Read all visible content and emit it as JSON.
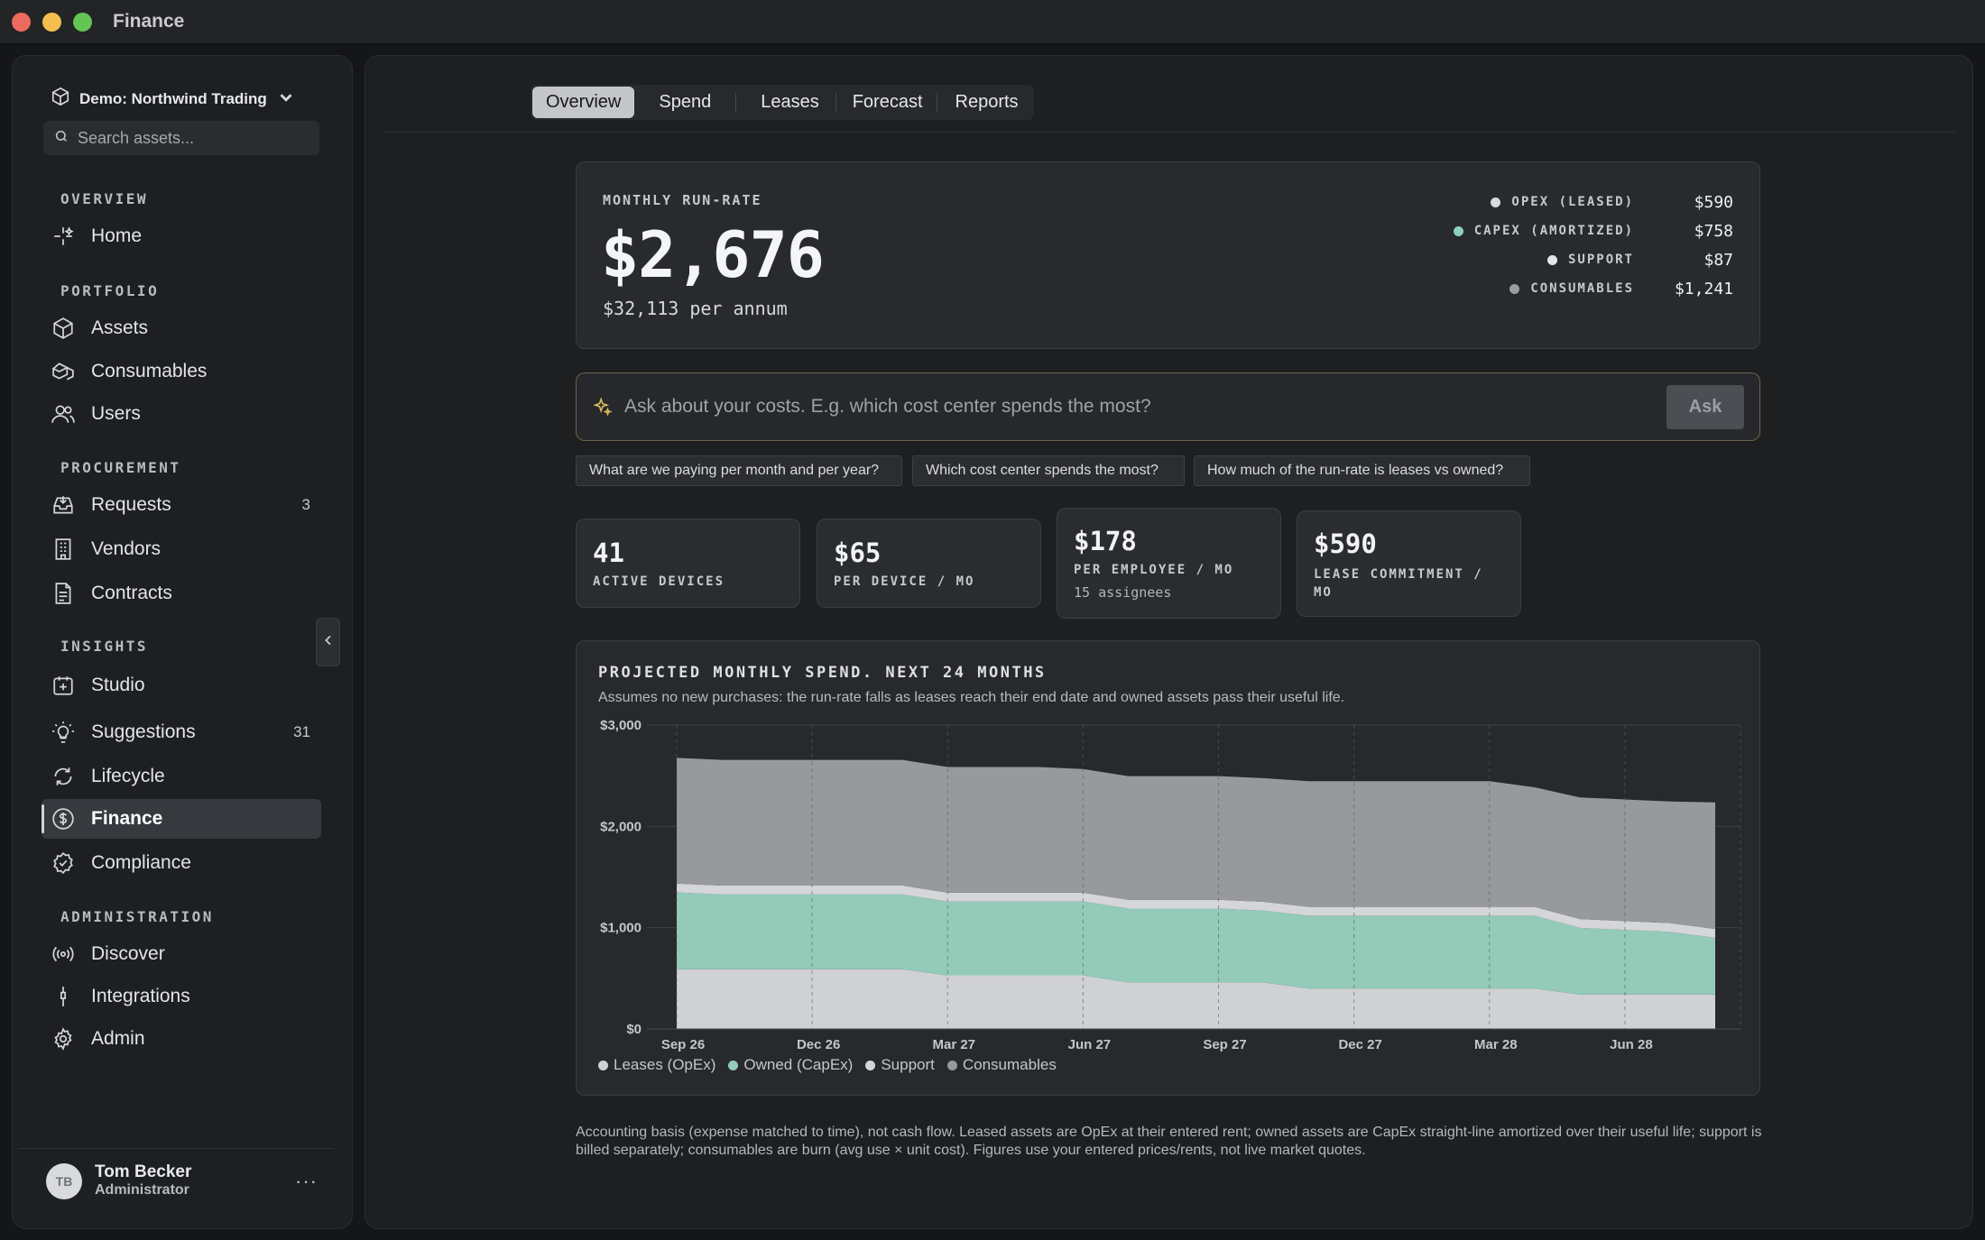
{
  "window": {
    "title": "Finance"
  },
  "sidebar": {
    "org_name": "Demo: Northwind Trading",
    "search_placeholder": "Search assets...",
    "sections": {
      "overview": "OVERVIEW",
      "portfolio": "PORTFOLIO",
      "procurement": "PROCUREMENT",
      "insights": "INSIGHTS",
      "administration": "ADMINISTRATION"
    },
    "items": {
      "home": "Home",
      "assets": "Assets",
      "consumables": "Consumables",
      "users": "Users",
      "requests": "Requests",
      "requests_count": "3",
      "vendors": "Vendors",
      "contracts": "Contracts",
      "studio": "Studio",
      "suggestions": "Suggestions",
      "suggestions_count": "31",
      "lifecycle": "Lifecycle",
      "finance": "Finance",
      "compliance": "Compliance",
      "discover": "Discover",
      "integrations": "Integrations",
      "admin": "Admin"
    },
    "user": {
      "initials": "TB",
      "name": "Tom Becker",
      "role": "Administrator",
      "more": "···"
    }
  },
  "tabs": [
    "Overview",
    "Spend",
    "Leases",
    "Forecast",
    "Reports"
  ],
  "active_tab": "Overview",
  "run_rate": {
    "label": "MONTHLY RUN-RATE",
    "amount": "$2,676",
    "annual": "$32,113 per annum",
    "breakdown": [
      {
        "label": "OPEX (LEASED)",
        "value": "$590",
        "color": "#d9dadd"
      },
      {
        "label": "CAPEX (AMORTIZED)",
        "value": "$758",
        "color": "#8fd0bb"
      },
      {
        "label": "SUPPORT",
        "value": "$87",
        "color": "#e4e5e7"
      },
      {
        "label": "CONSUMABLES",
        "value": "$1,241",
        "color": "#9a9ca1"
      }
    ]
  },
  "ask": {
    "placeholder": "Ask about your costs. E.g. which cost center spends the most?",
    "button": "Ask",
    "suggestions": [
      "What are we paying per month and per year?",
      "Which cost center spends the most?",
      "How much of the run-rate is leases vs owned?"
    ]
  },
  "stats": [
    {
      "value": "41",
      "label": "ACTIVE DEVICES",
      "sub": ""
    },
    {
      "value": "$65",
      "label": "PER DEVICE / MO",
      "sub": ""
    },
    {
      "value": "$178",
      "label": "PER EMPLOYEE / MO",
      "sub": "15 assignees"
    },
    {
      "value": "$590",
      "label": "LEASE COMMITMENT / MO",
      "sub": ""
    }
  ],
  "chart": {
    "title": "PROJECTED MONTHLY SPEND. NEXT 24 MONTHS",
    "subtitle": "Assumes no new purchases: the run-rate falls as leases reach their end date and owned assets pass their useful life."
  },
  "chart_data": {
    "type": "area",
    "stacked": true,
    "ylim": [
      0,
      3000
    ],
    "y_ticks": [
      "$0",
      "$1,000",
      "$2,000",
      "$3,000"
    ],
    "x_ticks": [
      "Sep 26",
      "Dec 26",
      "Mar 27",
      "Jun 27",
      "Sep 27",
      "Dec 27",
      "Mar 28",
      "Jun 28"
    ],
    "grid": true,
    "legend_position": "bottom-left",
    "x": [
      "Sep 26",
      "Oct 26",
      "Nov 26",
      "Dec 26",
      "Jan 27",
      "Feb 27",
      "Mar 27",
      "Apr 27",
      "May 27",
      "Jun 27",
      "Jul 27",
      "Aug 27",
      "Sep 27",
      "Oct 27",
      "Nov 27",
      "Dec 27",
      "Jan 28",
      "Feb 28",
      "Mar 28",
      "Apr 28",
      "May 28",
      "Jun 28",
      "Jul 28",
      "Aug 28"
    ],
    "series": [
      {
        "name": "Leases (OpEx)",
        "color": "#cfd1d5",
        "values": [
          590,
          590,
          590,
          590,
          590,
          590,
          530,
          530,
          530,
          530,
          460,
          460,
          460,
          460,
          400,
          400,
          400,
          400,
          400,
          400,
          340,
          340,
          340,
          340
        ]
      },
      {
        "name": "Owned (CapEx)",
        "color": "#93cab8",
        "values": [
          758,
          738,
          738,
          738,
          738,
          738,
          728,
          728,
          728,
          728,
          728,
          728,
          728,
          708,
          718,
          718,
          718,
          718,
          718,
          718,
          658,
          638,
          618,
          560
        ]
      },
      {
        "name": "Support",
        "color": "#d5d6d9",
        "values": [
          87,
          87,
          87,
          87,
          87,
          87,
          87,
          87,
          87,
          87,
          87,
          87,
          87,
          87,
          87,
          87,
          87,
          87,
          87,
          87,
          87,
          87,
          87,
          87
        ]
      },
      {
        "name": "Consumables",
        "color": "#97999d",
        "values": [
          1241,
          1241,
          1241,
          1241,
          1241,
          1241,
          1241,
          1241,
          1241,
          1221,
          1221,
          1221,
          1221,
          1221,
          1241,
          1241,
          1241,
          1241,
          1241,
          1181,
          1201,
          1201,
          1201,
          1250
        ]
      }
    ]
  },
  "footnote": "Accounting basis (expense matched to time), not cash flow. Leased assets are OpEx at their entered rent; owned assets are CapEx straight-line amortized over their useful life; support is billed separately; consumables are burn (avg use × unit cost). Figures use your entered prices/rents, not live market quotes."
}
